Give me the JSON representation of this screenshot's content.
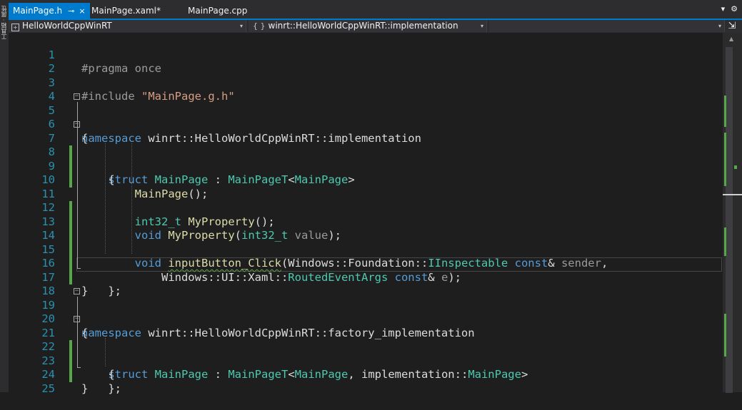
{
  "side_strip": {
    "label": "工具箱 · 属性"
  },
  "tabs": [
    {
      "label": "MainPage.h",
      "active": true,
      "pin": "⊸",
      "close": "×"
    },
    {
      "label": "MainPage.xaml*",
      "active": false
    },
    {
      "label": "MainPage.cpp",
      "active": false
    }
  ],
  "tab_overflow": {
    "dropdown": "▾",
    "settings": "⚙"
  },
  "nav": {
    "project": "HelloWorldCppWinRT",
    "scope": "winrt::HelloWorldCppWinRT::implementation",
    "member": "",
    "braces": "{ }",
    "arrow": "▾",
    "split": "⇲"
  },
  "code_lines": [
    {
      "n": "1"
    },
    {
      "n": "2"
    },
    {
      "n": "3"
    },
    {
      "n": "4"
    },
    {
      "n": "5"
    },
    {
      "n": "6"
    },
    {
      "n": "7"
    },
    {
      "n": "8"
    },
    {
      "n": "9"
    },
    {
      "n": "10"
    },
    {
      "n": "11"
    },
    {
      "n": "12"
    },
    {
      "n": "13"
    },
    {
      "n": "14"
    },
    {
      "n": "15"
    },
    {
      "n": "16"
    },
    {
      "n": "17"
    },
    {
      "n": "18"
    },
    {
      "n": "19"
    },
    {
      "n": "20"
    },
    {
      "n": "21"
    },
    {
      "n": "22"
    },
    {
      "n": "23"
    },
    {
      "n": "24"
    },
    {
      "n": "25"
    }
  ],
  "tokens": {
    "l1_pp": "#pragma once",
    "l3_pp": "#include ",
    "l3_str": "\"MainPage.g.h\"",
    "l5_kw": "namespace",
    "l5_rest": " winrt::HelloWorldCppWinRT::implementation",
    "l6": "{",
    "l7_kw": "struct",
    "l7_t1": "MainPage",
    "l7_sep": " : ",
    "l7_t2": "MainPageT",
    "l7_lt": "<",
    "l7_t3": "MainPage",
    "l7_gt": ">",
    "l8": "{",
    "l9_fn": "MainPage",
    "l9_rest": "();",
    "l11_ty": "int32_t",
    "l11_fn": "MyProperty",
    "l11_rest": "();",
    "l12_kw": "void",
    "l12_fn": "MyProperty",
    "l12_open": "(",
    "l12_ty": "int32_t",
    "l12_par": " value",
    "l12_close": ");",
    "l14_kw": "void",
    "l14_fn": "inputButton_Click",
    "l14_open": "(Windows::Foundation::",
    "l14_ty": "IInspectable",
    "l14_const": "const",
    "l14_amp": "&",
    "l14_par": " sender",
    "l14_comma": ",",
    "l15_a": "Windows::UI::Xaml::",
    "l15_ty": "RoutedEventArgs",
    "l15_const": "const",
    "l15_amp": "&",
    "l15_par": " e",
    "l15_close": ");",
    "l16": "};",
    "l17": "}",
    "l19_kw": "namespace",
    "l19_rest": " winrt::HelloWorldCppWinRT::factory_implementation",
    "l20": "{",
    "l21_kw": "struct",
    "l21_t1": "MainPage",
    "l21_sep": " : ",
    "l21_t2": "MainPageT",
    "l21_lt": "<",
    "l21_t3": "MainPage",
    "l21_mid": ", implementation::",
    "l21_t4": "MainPage",
    "l21_gt": ">",
    "l22": "{",
    "l23": "};",
    "l24": "}"
  },
  "colors": {
    "keyword": "#569cd6",
    "type": "#4ec9b0",
    "function": "#dcdcaa",
    "string": "#d69d85",
    "preprocessor": "#9b9b9b",
    "line_number": "#2b91af",
    "changed_line": "#57a64a",
    "active_tab": "#007acc"
  }
}
